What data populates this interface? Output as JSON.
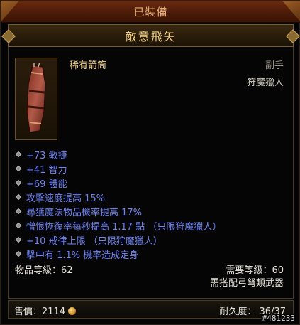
{
  "header": {
    "equipped_label": "已裝備"
  },
  "item": {
    "name": "敵意飛矢",
    "type": "稀有箭筒",
    "slot": "副手",
    "class_name": "狩魔獵人",
    "icon": "quiver-icon",
    "affixes": [
      "+73 敏捷",
      "+41 智力",
      "+69 體能",
      "攻擊速度提高 15%",
      "尋獲魔法物品機率提高 17%",
      "憎恨恢復率每秒提高 1.17 點 （只限狩魔獵人）",
      "+10 戒律上限 （只限狩魔獵人）",
      "擊中有 1.1% 機率造成定身"
    ],
    "item_level": "物品等級：62",
    "required_level": "需要等級：60",
    "required_weapon": "需搭配弓弩類武器",
    "sell_price_label": "售價：2114",
    "durability": "耐久度： 36/37"
  },
  "watermark": "#481233",
  "colors": {
    "title": "#f0d080",
    "affix": "#6f84f0",
    "header_bar": "#5a2210"
  }
}
